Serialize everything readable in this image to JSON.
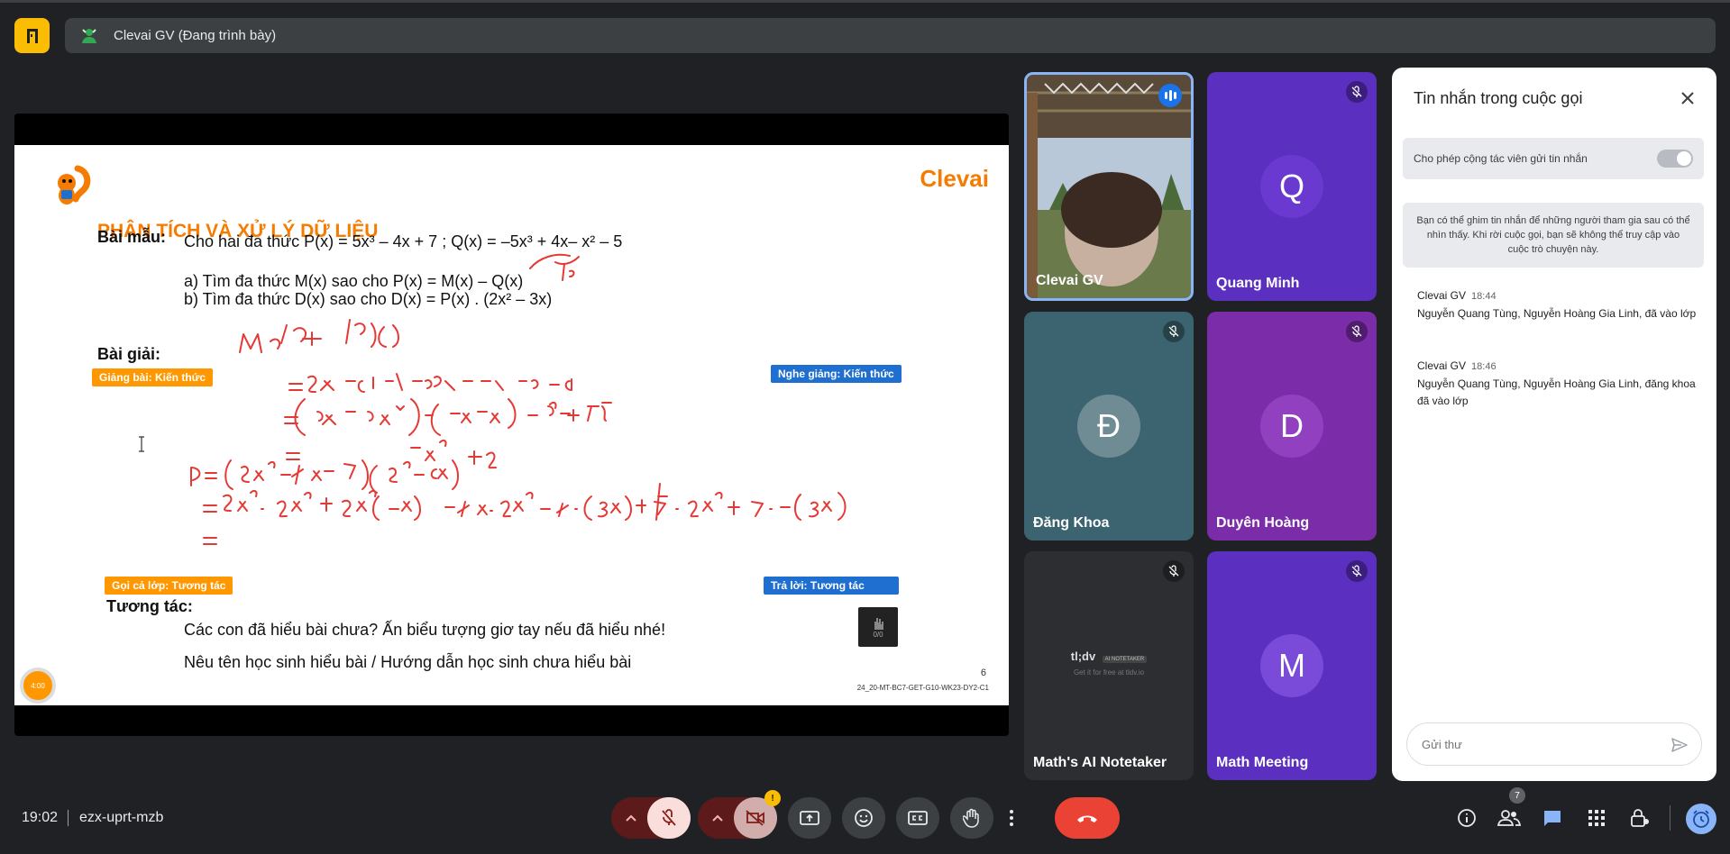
{
  "colors": {
    "background": "#202124",
    "accent": "#8ab4f8",
    "end_call": "#ea4335",
    "app_icon": "#fbbc04",
    "slide_orange": "#f57c00"
  },
  "presentation": {
    "title": "Clevai GV (Đang trình bày)"
  },
  "slide": {
    "brand": "Clevai",
    "title": "PHÂN TÍCH VÀ XỬ LÝ DỮ LIỆU",
    "sample_label": "Bài mẫu:",
    "problem": "Cho hai đa thức P(x) = 5x³ – 4x + 7 ; Q(x) = –5x³ + 4x– x² – 5",
    "part_a": "a)    Tìm đa thức M(x) sao cho P(x) = M(x) – Q(x)",
    "part_b": "b)   Tìm đa thức D(x) sao cho D(x) = P(x) . (2x² – 3x)",
    "solution_label": "Bài giải:",
    "tag_teach": "Giảng bài: Kiến thức",
    "tag_listen": "Nghe giảng: Kiến thức",
    "tag_call": "Gọi cả lớp: Tương tác",
    "tag_answer": "Trả lời: Tương tác",
    "interact_label": "Tương tác:",
    "interact_line1": "Các con đã hiểu bài chưa? Ấn biểu tượng giơ tay nếu đã hiểu nhé!",
    "interact_line2": "Nêu tên học sinh hiểu bài / Hướng dẫn học sinh chưa hiểu bài",
    "hand_count": "0/0",
    "timer": "4:00",
    "slide_number": "6",
    "slide_code": "24_20-MT-BC7-GET-G10-WK23-DY2-C1"
  },
  "participants": [
    {
      "name": "Clevai GV",
      "initial": "",
      "color": "#6b7a5a",
      "speaking": true
    },
    {
      "name": "Quang Minh",
      "initial": "Q",
      "color": "#5b2fc0",
      "avatar_color": "#6a3ad0"
    },
    {
      "name": "Đăng Khoa",
      "initial": "Đ",
      "color": "#3c6470",
      "avatar_color": "#6f8c94"
    },
    {
      "name": "Duyên Hoàng",
      "initial": "D",
      "color": "#7b2ca8",
      "avatar_color": "#9140c0"
    },
    {
      "name": "Math's AI Notetaker",
      "initial": "",
      "color": "#2d2e31"
    },
    {
      "name": "Math Meeting",
      "initial": "M",
      "color": "#5b2fc0",
      "avatar_color": "#7a4ad8"
    }
  ],
  "notetaker": {
    "logo": "tl;dv",
    "badge": "AI NOTETAKER",
    "sub": "Get it for free at tldv.io"
  },
  "chat": {
    "title": "Tin nhắn trong cuộc gọi",
    "toggle_label": "Cho phép cộng tác viên gửi tin nhắn",
    "info": "Bạn có thể ghim tin nhắn để những người tham gia sau có thể nhìn thấy. Khi rời cuộc gọi, bạn sẽ không thể truy cập vào cuộc trò chuyện này.",
    "messages": [
      {
        "sender": "Clevai GV",
        "time": "18:44",
        "text": "Nguyễn Quang Tùng, Nguyễn Hoàng Gia Linh, đã vào lớp"
      },
      {
        "sender": "Clevai GV",
        "time": "18:46",
        "text": "Nguyễn Quang Tùng, Nguyễn Hoàng Gia Linh, đăng khoa đã vào lớp"
      }
    ],
    "input_placeholder": "Gửi thư"
  },
  "bottom_bar": {
    "time": "19:02",
    "meeting_code": "ezx-uprt-mzb",
    "people_count": "7",
    "camera_alert": "!"
  }
}
